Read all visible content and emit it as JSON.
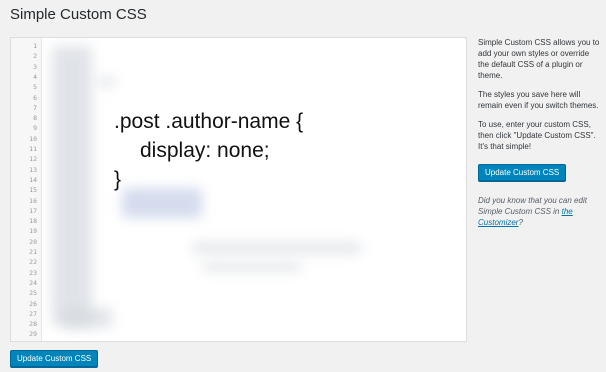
{
  "page": {
    "title": "Simple Custom CSS"
  },
  "editor": {
    "line_numbers": [
      "1",
      "2",
      "3",
      "4",
      "5",
      "6",
      "7",
      "8",
      "9",
      "10",
      "11",
      "12",
      "13",
      "14",
      "15",
      "16",
      "17",
      "18",
      "19",
      "20",
      "21",
      "22",
      "23",
      "24",
      "25",
      "26",
      "27",
      "28",
      "29"
    ],
    "code_lines": [
      ".post .author-name {",
      "display: none;",
      "}"
    ]
  },
  "sidebar": {
    "intro": "Simple Custom CSS allows you to add your own styles or override the default CSS of a plugin or theme.",
    "persist": "The styles you save here will remain even if you switch themes.",
    "instructions": "To use, enter your custom CSS, then click \"Update Custom CSS\". It's that simple!",
    "button_label": "Update Custom CSS",
    "note_prefix": "Did you know that you can edit Simple Custom CSS in",
    "note_link": "the Customizer",
    "note_suffix": "?"
  },
  "footer": {
    "button_label": "Update Custom CSS"
  },
  "colors": {
    "primary_button": "#0085ba",
    "link": "#0073aa",
    "background": "#f1f1f1"
  }
}
